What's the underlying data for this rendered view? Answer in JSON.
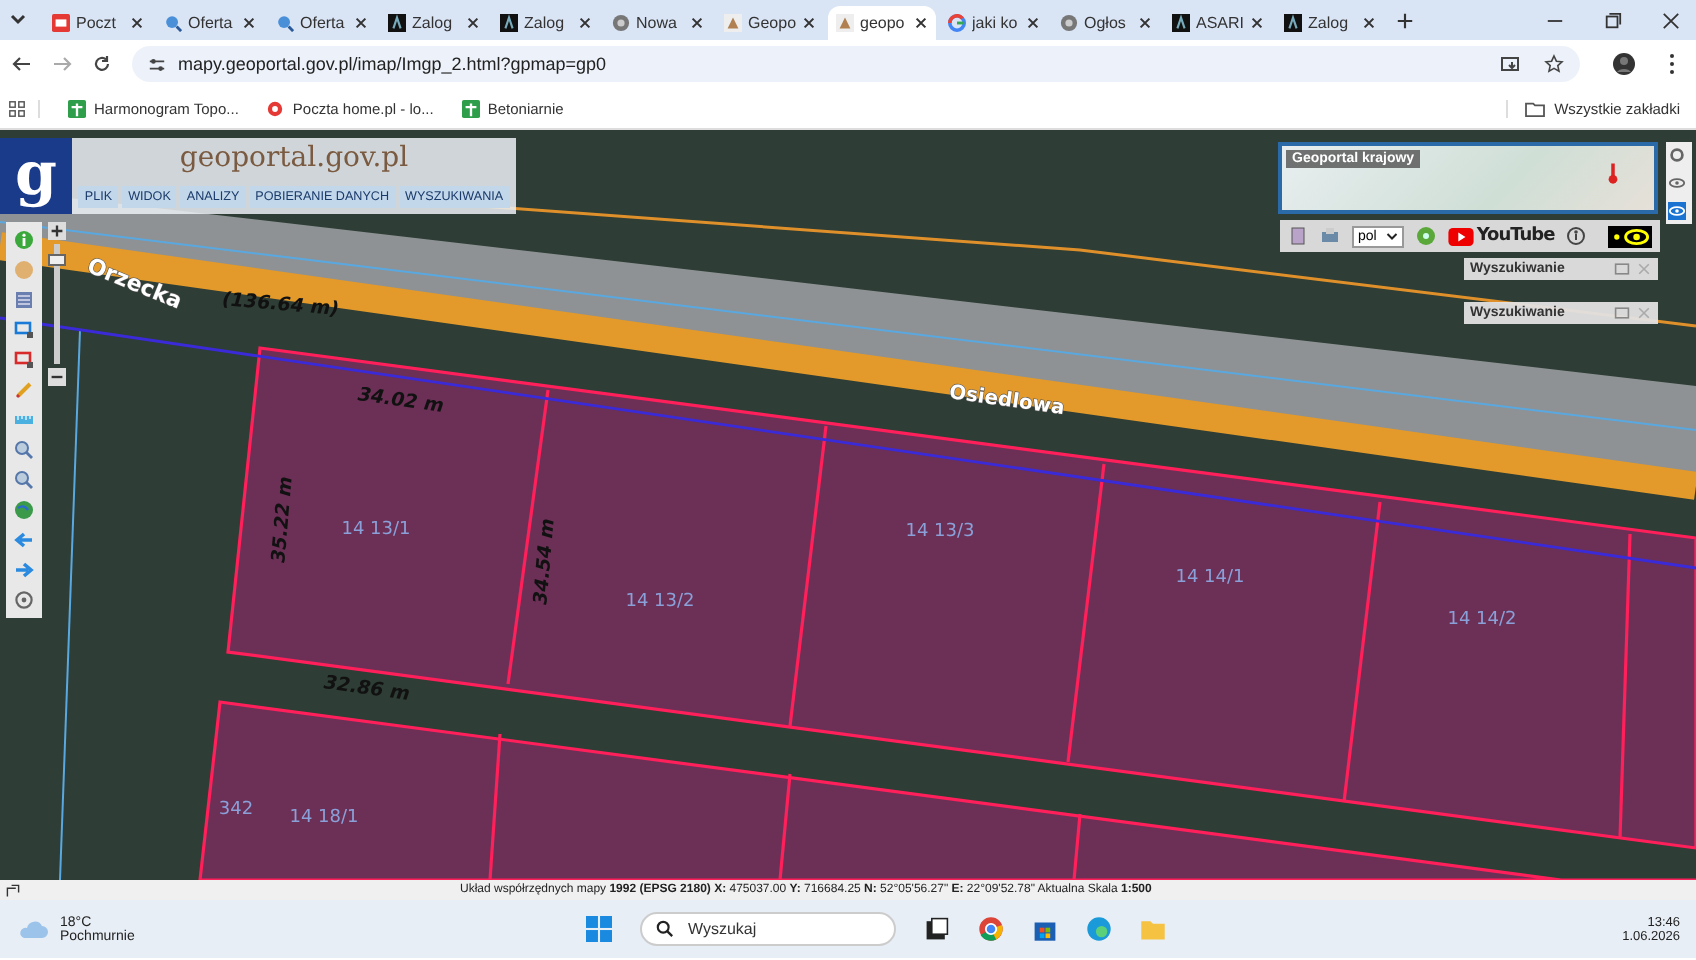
{
  "browser": {
    "tabs": [
      {
        "label": "Poczt",
        "kind": "mail",
        "selected": false
      },
      {
        "label": "Oferta",
        "kind": "search",
        "selected": false
      },
      {
        "label": "Oferta",
        "kind": "search",
        "selected": false
      },
      {
        "label": "Zalog",
        "kind": "letter",
        "selected": false
      },
      {
        "label": "Zalog",
        "kind": "letter",
        "selected": false
      },
      {
        "label": "Nowa",
        "kind": "globe",
        "selected": false
      },
      {
        "label": "Geopo",
        "kind": "geoportal",
        "selected": false
      },
      {
        "label": "geopo",
        "kind": "geoportal",
        "selected": true
      },
      {
        "label": "jaki ko",
        "kind": "google",
        "selected": false
      },
      {
        "label": "Ogłos",
        "kind": "globe",
        "selected": false
      },
      {
        "label": "ASARI",
        "kind": "letter",
        "selected": false
      },
      {
        "label": "Zalog",
        "kind": "letter",
        "selected": false
      }
    ],
    "url": "mapy.geoportal.gov.pl/imap/Imgp_2.html?gpmap=gp0",
    "bookmarks": [
      {
        "label": "Harmonogram Topo...",
        "kind": "sheet"
      },
      {
        "label": "Poczta home.pl - lo...",
        "kind": "mail"
      },
      {
        "label": "Betoniarnie",
        "kind": "sheet"
      }
    ],
    "all_bookmarks": "Wszystkie zakładki"
  },
  "geoportal": {
    "logo": "g",
    "title": "geoportal.gov.pl",
    "menu": [
      "PLIK",
      "WIDOK",
      "ANALIZY",
      "POBIERANIE DANYCH",
      "WYSZUKIWANIA"
    ],
    "overview_title": "Geoportal krajowy",
    "language": "pol",
    "video_brand": "YouTube",
    "search_panels": [
      "Wyszukiwanie",
      "Wyszukiwanie"
    ]
  },
  "map": {
    "zoom": {
      "level": 0.9
    },
    "streets": [
      "Orzecka",
      "Osiedlowa"
    ],
    "measurements": [
      "(136.64 m)",
      "34.02 m",
      "35.22 m",
      "34.54 m",
      "32.86 m"
    ],
    "parcels": [
      "14 13/1",
      "14 13/2",
      "14 13/3",
      "14 14/1",
      "14 14/2",
      "342",
      "14 18/1"
    ]
  },
  "status_bar": "Układ współrzędnych mapy **1992 (EPSG 2180)** **X:** 475037.00 **Y:** 716684.25 **N:** 52°05'56.27\" **E:** 22°09'52.78\" Aktualna Skala **1:500**",
  "taskbar": {
    "temperature": "18°C",
    "weather": "Pochmurnie",
    "search_placeholder": "Wyszukaj",
    "time": "13:46",
    "date": "1.06.2026"
  }
}
